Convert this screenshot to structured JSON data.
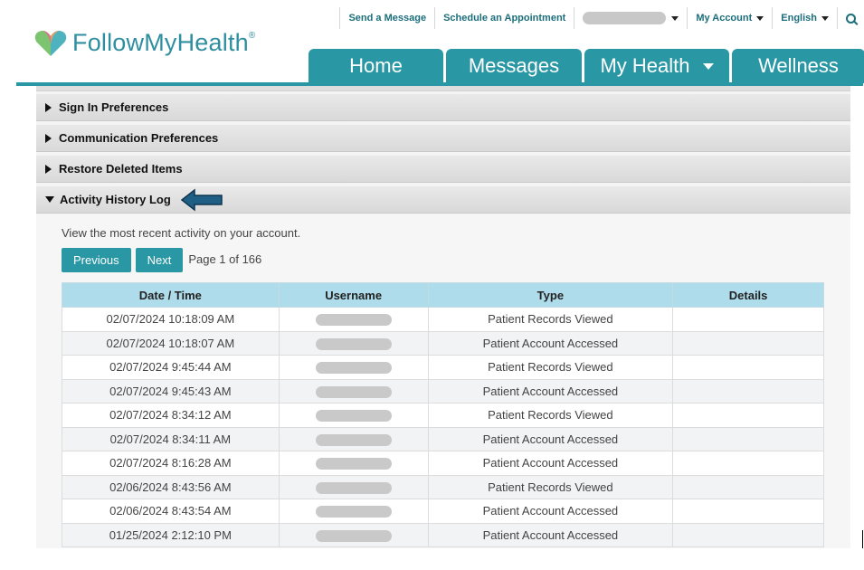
{
  "utility_bar": {
    "send_message": "Send a Message",
    "schedule_appointment": "Schedule an Appointment",
    "my_account": "My Account",
    "language": "English"
  },
  "logo": {
    "text": "FollowMyHealth",
    "mark": "®"
  },
  "nav": {
    "tabs": [
      {
        "label": "Home",
        "has_dropdown": false
      },
      {
        "label": "Messages",
        "has_dropdown": false
      },
      {
        "label": "My Health",
        "has_dropdown": true
      },
      {
        "label": "Wellness",
        "has_dropdown": false
      }
    ]
  },
  "accordion": {
    "sections": [
      {
        "label": "Sign In Preferences",
        "expanded": false
      },
      {
        "label": "Communication Preferences",
        "expanded": false
      },
      {
        "label": "Restore Deleted Items",
        "expanded": false
      },
      {
        "label": "Activity History Log",
        "expanded": true
      }
    ]
  },
  "activity_log": {
    "intro": "View the most recent activity on your account.",
    "previous_label": "Previous",
    "next_label": "Next",
    "page_info": "Page 1 of 166",
    "columns": [
      "Date / Time",
      "Username",
      "Type",
      "Details"
    ],
    "rows": [
      {
        "datetime": "02/07/2024 10:18:09 AM",
        "type": "Patient Records Viewed",
        "details": ""
      },
      {
        "datetime": "02/07/2024 10:18:07 AM",
        "type": "Patient Account Accessed",
        "details": ""
      },
      {
        "datetime": "02/07/2024 9:45:44 AM",
        "type": "Patient Records Viewed",
        "details": ""
      },
      {
        "datetime": "02/07/2024 9:45:43 AM",
        "type": "Patient Account Accessed",
        "details": ""
      },
      {
        "datetime": "02/07/2024 8:34:12 AM",
        "type": "Patient Records Viewed",
        "details": ""
      },
      {
        "datetime": "02/07/2024 8:34:11 AM",
        "type": "Patient Account Accessed",
        "details": ""
      },
      {
        "datetime": "02/07/2024 8:16:28 AM",
        "type": "Patient Account Accessed",
        "details": ""
      },
      {
        "datetime": "02/06/2024 8:43:56 AM",
        "type": "Patient Records Viewed",
        "details": ""
      },
      {
        "datetime": "02/06/2024 8:43:54 AM",
        "type": "Patient Account Accessed",
        "details": ""
      },
      {
        "datetime": "01/25/2024 2:12:10 PM",
        "type": "Patient Account Accessed",
        "details": ""
      }
    ]
  },
  "colors": {
    "brand_teal": "#2a97a5",
    "table_header": "#aedcea",
    "callout_arrow": "#1f5f86"
  }
}
